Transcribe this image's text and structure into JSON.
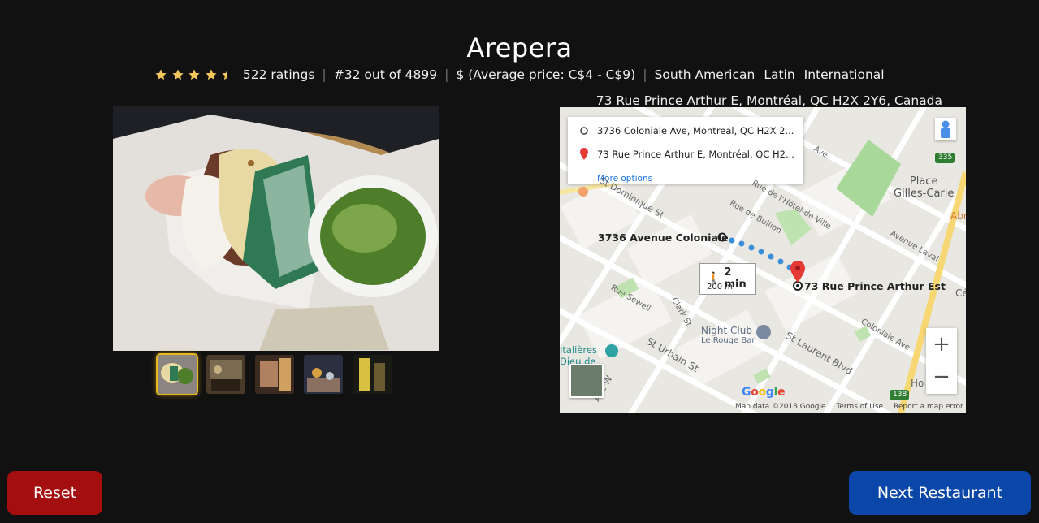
{
  "restaurant": {
    "name": "Arepera",
    "rating": 4.5,
    "ratings_text": "522 ratings",
    "rank": "#32 out of 4899",
    "price": "$ (Average price: C$4 - C$9)",
    "cuisines": [
      "South American",
      "Latin",
      "International"
    ],
    "address": "73 Rue Prince Arthur E, Montréal, QC H2X 2Y6, Canada"
  },
  "gallery": {
    "thumbnails": [
      "photo-1",
      "photo-2",
      "photo-3",
      "photo-4",
      "photo-5"
    ],
    "active_index": 0
  },
  "map": {
    "origin_field": "3736 Coloniale Ave, Montreal, QC H2X 2...",
    "destination_field": "73 Rue Prince Arthur E, Montréal, QC H2...",
    "more_options": "More options",
    "origin_label": "3736 Avenue Coloniale",
    "destination_label": "73 Rue Prince Arthur Est",
    "walk_time": "2 min",
    "walk_distance": "200 m",
    "zoom_in": "+",
    "zoom_out": "−",
    "street_labels": {
      "st_dominique": "St Dominique St",
      "rue_hdv": "Rue de l'Hôtel-de-Ville",
      "rue_bullion": "Rue de Bullion",
      "avenue_laval": "Avenue Laval",
      "rue_sewell": "Rue Sewell",
      "clark": "Clark St",
      "st_urbain": "St Urbain St",
      "st_laurent": "St Laurent Blvd",
      "coloniale": "Coloniale Ave",
      "ave": "Ave",
      "ave_w": "Ave W",
      "place_gilles": "Place\nGilles-Carle",
      "abre": "Abre",
      "ceg": "Cég",
      "ho": "Ho"
    },
    "poi": {
      "night_club": "Night Club",
      "rouge_bar": "Le Rouge Bar",
      "italieres": "Italières",
      "dieu": "Dieu de"
    },
    "route_numbers": [
      "335",
      "138"
    ],
    "google": "Google",
    "footer": {
      "map_data": "Map data ©2018 Google",
      "terms": "Terms of Use",
      "report": "Report a map error"
    },
    "colors": {
      "route": "#3a8fd8",
      "pin": "#e53935",
      "park": "#a8d89a"
    }
  },
  "actions": {
    "reset": "Reset",
    "next": "Next Restaurant"
  },
  "colors": {
    "background": "#111111",
    "reset_button": "#a50e0e",
    "next_button": "#0b46a9",
    "star": "#f5c75a",
    "thumb_highlight": "#e6b81e"
  }
}
